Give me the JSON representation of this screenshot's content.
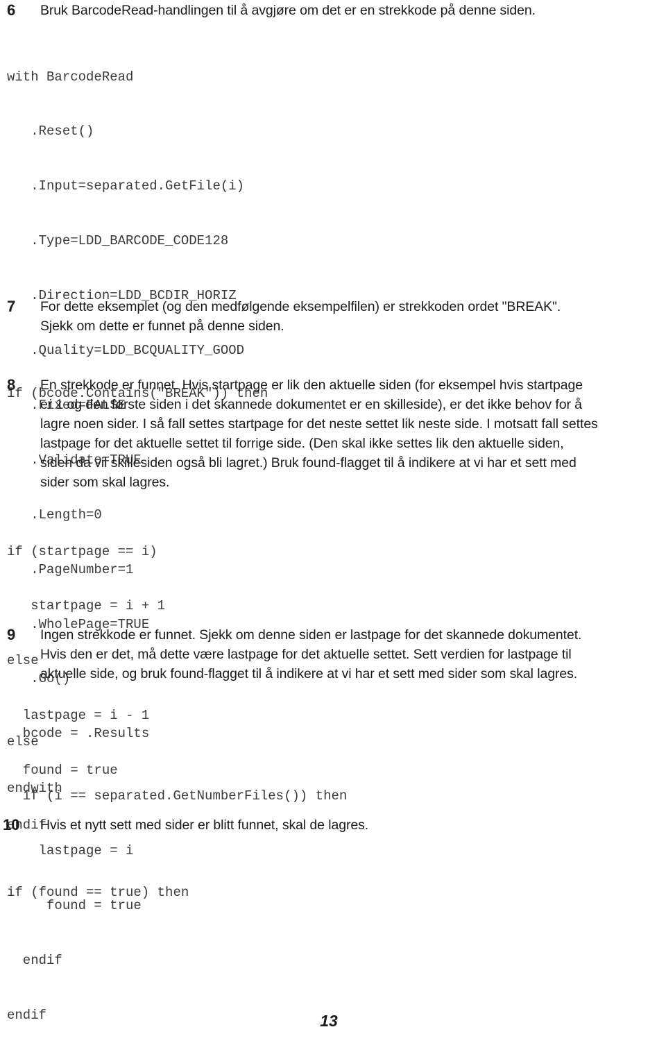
{
  "document": {
    "page_number": "13",
    "blocks": [
      {
        "type": "step",
        "number": "6",
        "lines": [
          "Bruk BarcodeRead-handlingen til å avgjøre om det er en strekkode på denne siden."
        ]
      },
      {
        "type": "code",
        "lines": [
          "with BarcodeRead",
          "   .Reset()",
          "   .Input=separated.GetFile(i)",
          "   .Type=LDD_BARCODE_CODE128",
          "   .Direction=LDD_BCDIR_HORIZ",
          "   .Quality=LDD_BCQUALITY_GOOD",
          "   .Fixed=FALSE",
          "   .Validate=TRUE",
          "   .Length=0",
          "   .PageNumber=1",
          "   .WholePage=TRUE",
          "   .Go()",
          "  bcode = .Results",
          "endwith"
        ]
      },
      {
        "type": "step",
        "number": "7",
        "lines": [
          "For dette eksemplet (og den medfølgende eksempelfilen) er strekkoden ordet \"BREAK\".",
          "Sjekk om dette er funnet på denne siden."
        ]
      },
      {
        "type": "code",
        "lines": [
          "if (bcode.Contains(\"BREAK\")) then"
        ]
      },
      {
        "type": "step",
        "number": "8",
        "lines": [
          "En strekkode er funnet. Hvis startpage er lik den aktuelle siden (for eksempel hvis startpage",
          "er 1 og den første siden i det skannede dokumentet er en skilleside), er det ikke behov for å",
          "lagre noen sider. I så fall settes startpage for det neste settet lik neste side. I motsatt fall settes",
          "lastpage for det aktuelle settet til forrige side. (Den skal ikke settes lik den aktuelle siden,",
          "siden da vil skillesiden også bli lagret.) Bruk found-flagget til å indikere at vi har et sett med",
          "sider som skal lagres."
        ]
      },
      {
        "type": "code",
        "lines": [
          "if (startpage == i)",
          "   startpage = i + 1",
          "else",
          "  lastpage = i - 1",
          "  found = true",
          "endif"
        ]
      },
      {
        "type": "step",
        "number": "9",
        "lines": [
          "Ingen strekkode er funnet. Sjekk om denne siden er lastpage for det skannede dokumentet.",
          "Hvis den er det, må dette være lastpage for det aktuelle settet. Sett verdien for lastpage til",
          "aktuelle side, og bruk found-flagget til å indikere at vi har et sett med sider som skal lagres."
        ]
      },
      {
        "type": "code",
        "lines": [
          "else",
          "  if (i == separated.GetNumberFiles()) then",
          "    lastpage = i",
          "     found = true",
          "  endif",
          "endif"
        ]
      },
      {
        "type": "step",
        "number": "10",
        "lines": [
          "Hvis et nytt sett med sider er blitt funnet, skal de lagres."
        ]
      },
      {
        "type": "code",
        "lines": [
          "if (found == true) then"
        ]
      }
    ]
  }
}
